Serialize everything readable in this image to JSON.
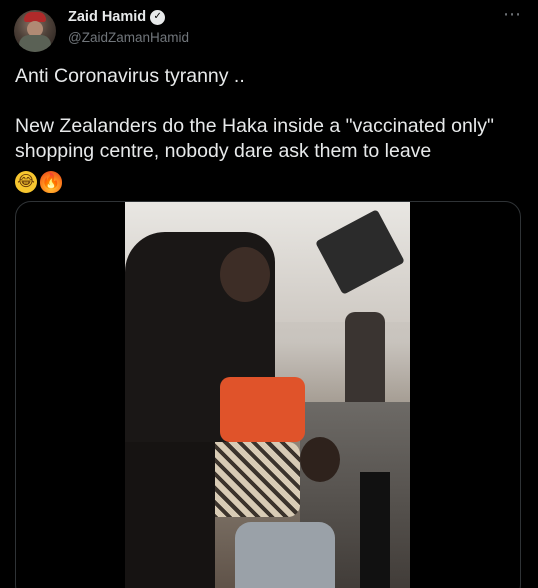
{
  "author": {
    "display_name": "Zaid Hamid",
    "handle": "@ZaidZamanHamid",
    "verified": true
  },
  "tweet": {
    "line1": "Anti Coronavirus tyranny ..",
    "line2": "New Zealanders do the Haka inside a \"vaccinated only\" shopping centre, nobody dare ask them to leave",
    "emojis": [
      "laughing-tears-emoji",
      "fire-emoji"
    ]
  },
  "menu": {
    "more_icon": "⋯"
  },
  "colors": {
    "background": "#000000",
    "text": "#e7e9ea",
    "secondary": "#71767b",
    "border": "#2f3336"
  }
}
